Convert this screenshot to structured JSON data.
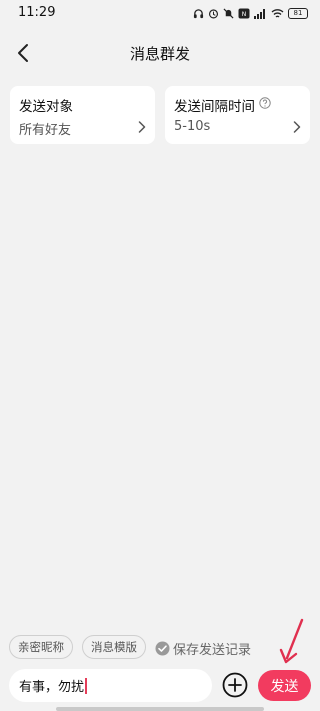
{
  "status_bar": {
    "time": "11:29",
    "battery": "81"
  },
  "header": {
    "title": "消息群发"
  },
  "cards": {
    "target": {
      "title": "发送对象",
      "value": "所有好友"
    },
    "interval": {
      "title": "发送间隔时间",
      "value": "5-10s"
    }
  },
  "bottom": {
    "chips": [
      "亲密昵称",
      "消息模版"
    ],
    "save_record_label": "保存发送记录",
    "save_record_checked": true,
    "input_value": "有事，勿扰",
    "send_label": "发送"
  },
  "colors": {
    "accent": "#f23b5f",
    "background": "#f2f2f2",
    "annotation_arrow": "#e0304f"
  },
  "icons": [
    "headphone-icon",
    "alarm-icon",
    "mute-icon",
    "nfc-icon",
    "signal-icon",
    "wifi-icon",
    "battery-icon",
    "back-arrow-icon",
    "chevron-right-icon",
    "help-icon",
    "check-circle-icon",
    "plus-circle-icon"
  ]
}
